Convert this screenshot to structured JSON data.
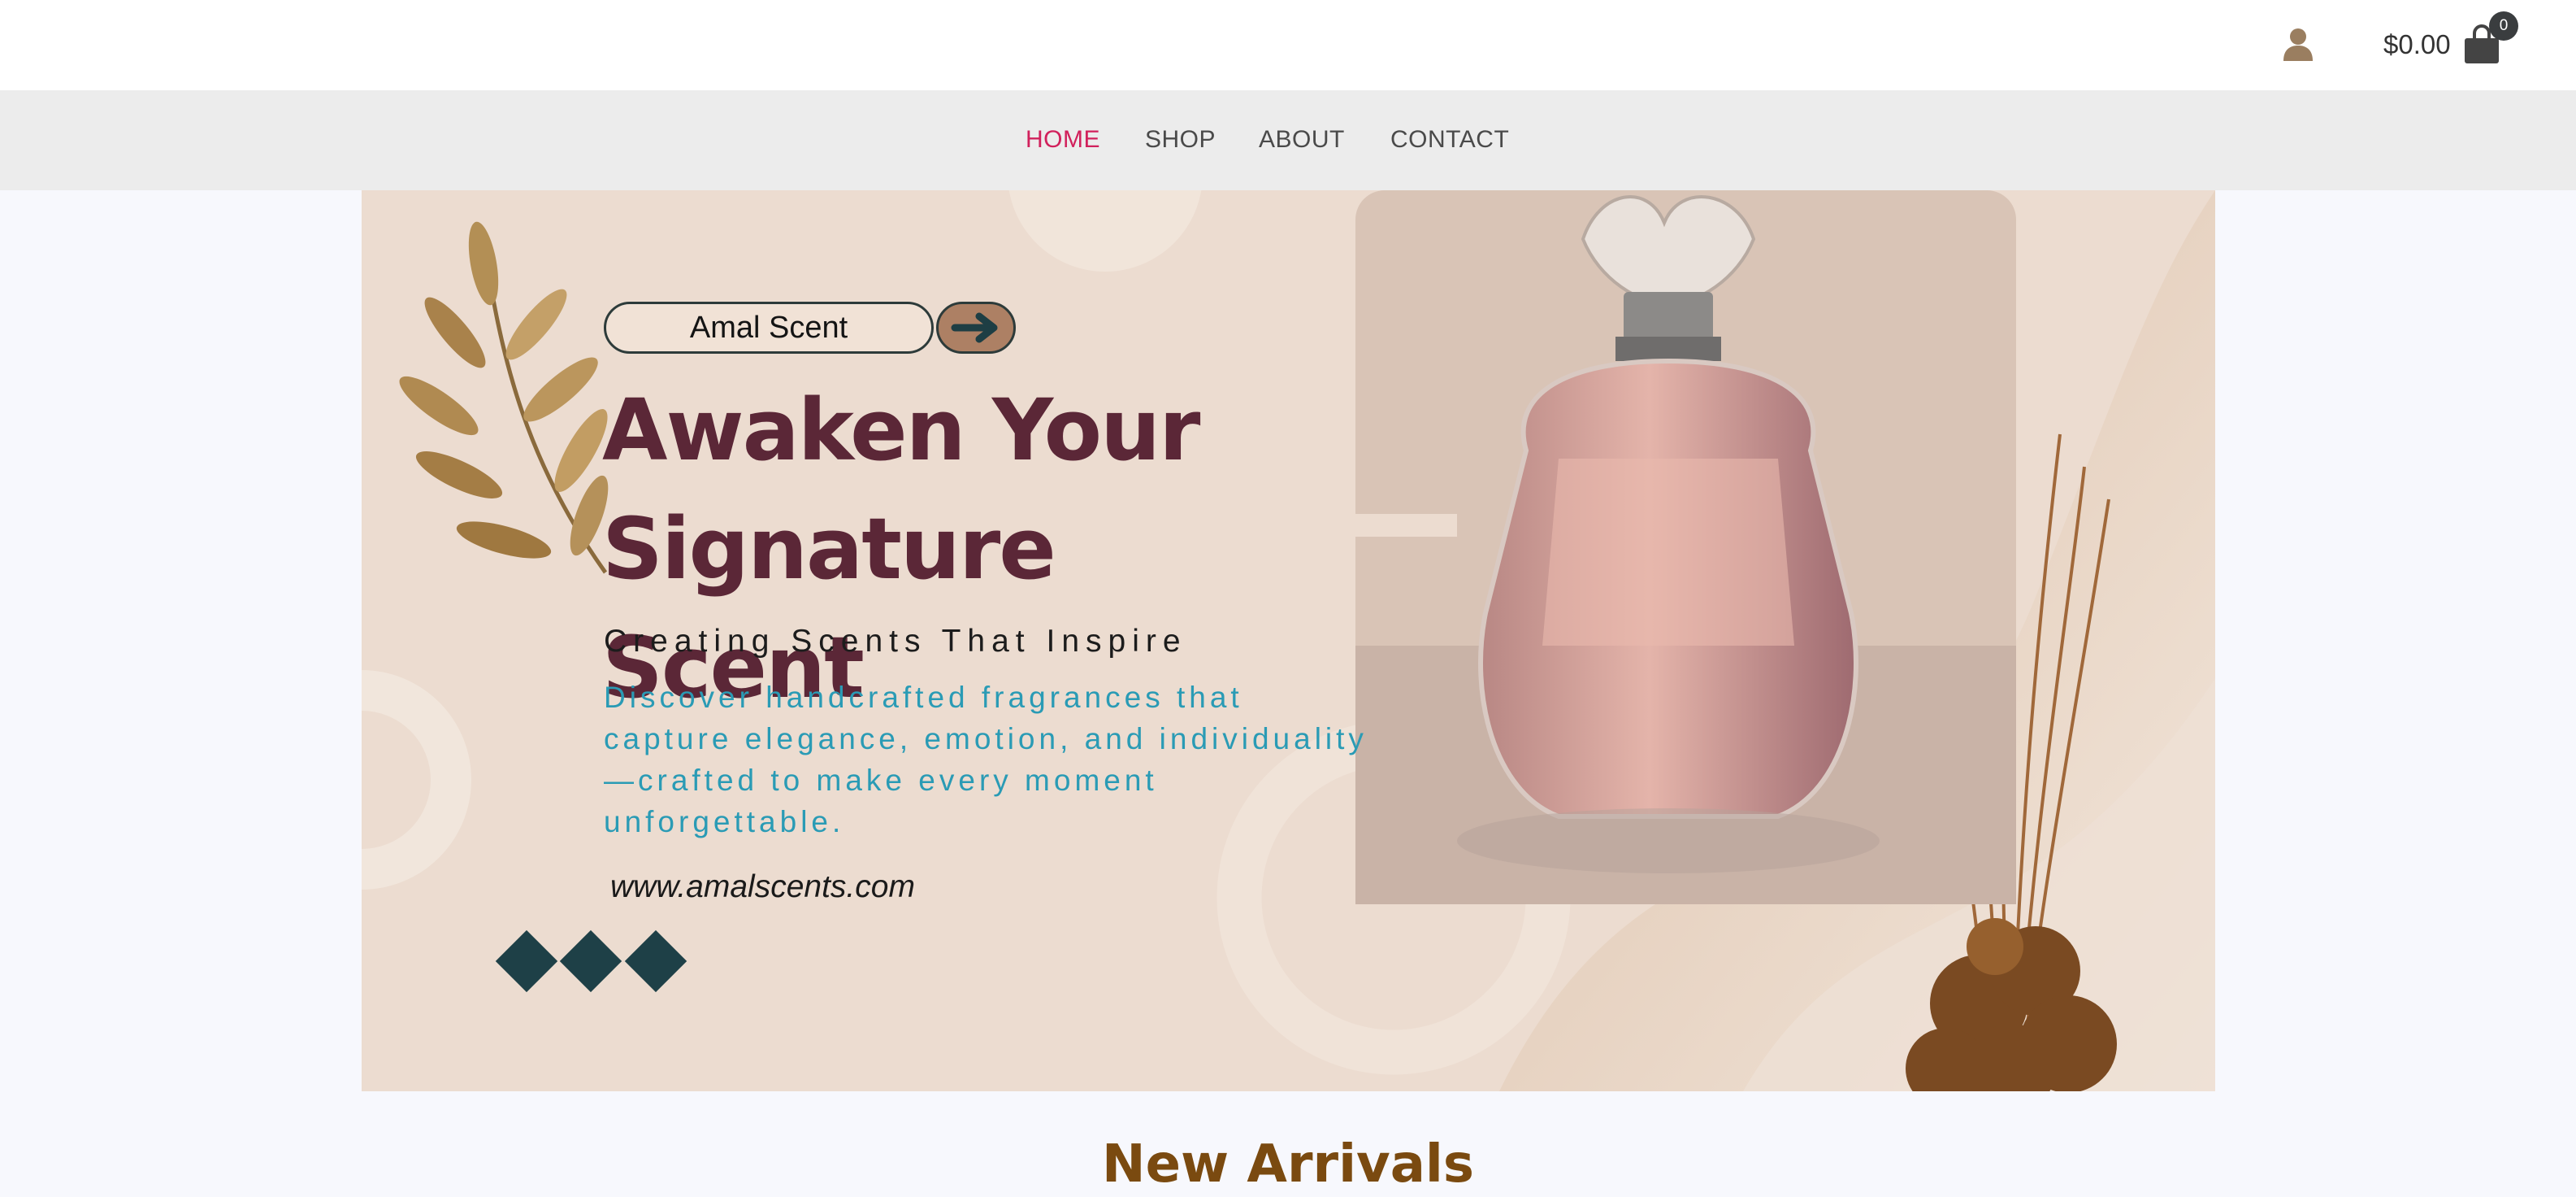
{
  "header": {
    "account_icon": "user-icon",
    "cart_total": "$0.00",
    "cart_icon": "shopping-bag-icon",
    "cart_count": "0"
  },
  "nav": {
    "items": [
      {
        "label": "HOME",
        "active": true
      },
      {
        "label": "SHOP",
        "active": false
      },
      {
        "label": "ABOUT",
        "active": false
      },
      {
        "label": "CONTACT",
        "active": false
      }
    ],
    "active_color": "#d1215c"
  },
  "hero": {
    "brand": "Amal Scent",
    "arrow_icon": "arrow-right-icon",
    "headline_line1": "Awaken Your",
    "headline_line2": "Signature Scent",
    "tagline": "Creating Scents That Inspire",
    "description": "Discover handcrafted fragrances that capture elegance, emotion, and individuality—crafted to make every moment unforgettable.",
    "website": "www.amalscents.com",
    "colors": {
      "headline": "#5b2737",
      "description": "#2a9bb5",
      "diamonds": "#1e4047",
      "background": "#ecdcd0"
    }
  },
  "sections": {
    "new_arrivals_title": "New Arrivals"
  }
}
